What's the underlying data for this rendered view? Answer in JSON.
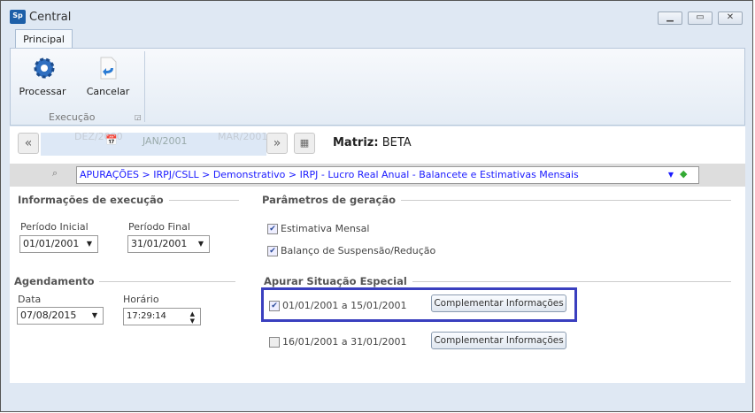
{
  "window": {
    "title": "Central",
    "logo": "Sp"
  },
  "ribbon": {
    "tab": "Principal",
    "buttons": [
      {
        "label": "Processar",
        "icon": "gear-icon"
      },
      {
        "label": "Cancelar",
        "icon": "cancel-document-icon"
      }
    ],
    "group": "Execução"
  },
  "period": {
    "prev": "DEZ/2000",
    "current": "JAN/2001",
    "next": "MAR/2001"
  },
  "matriz": {
    "label": "Matriz:",
    "value": "BETA"
  },
  "breadcrumb": "APURAÇÕES > IRPJ/CSLL > Demonstrativo > IRPJ - Lucro Real Anual - Balancete e Estimativas Mensais",
  "exec": {
    "title": "Informações de execução",
    "inicial_label": "Período  Inicial",
    "inicial": "01/01/2001",
    "final_label": "Período Final",
    "final": "31/01/2001"
  },
  "agend": {
    "title": "Agendamento",
    "data_label": "Data",
    "data": "07/08/2015",
    "hora_label": "Horário",
    "hora": "17:29:14"
  },
  "params": {
    "title": "Parâmetros de geração",
    "items": [
      {
        "label": "Estimativa Mensal",
        "checked": true
      },
      {
        "label": "Balanço de Suspensão/Redução",
        "checked": true
      }
    ]
  },
  "especial": {
    "title": "Apurar Situação Especial",
    "items": [
      {
        "label": "01/01/2001 a 15/01/2001",
        "checked": true,
        "button": "Complementar Informações"
      },
      {
        "label": "16/01/2001 a 31/01/2001",
        "checked": false,
        "button": "Complementar Informações"
      }
    ]
  },
  "colors": {
    "highlight": "#3a3fbf",
    "link": "#1a1aff"
  }
}
